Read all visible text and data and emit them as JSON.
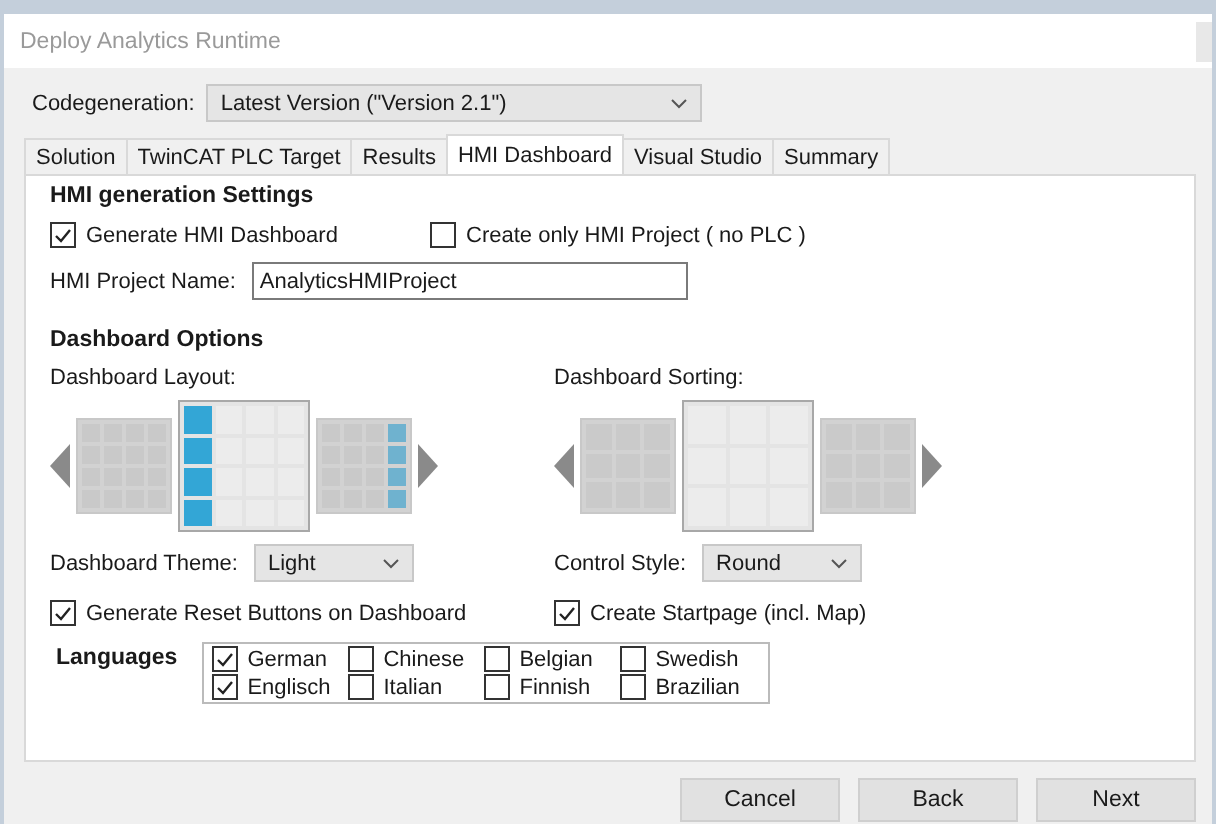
{
  "window": {
    "title": "Deploy Analytics Runtime"
  },
  "codegeneration": {
    "label": "Codegeneration:",
    "value": "Latest Version (\"Version 2.1\")"
  },
  "tabs": [
    {
      "label": "Solution",
      "selected": false
    },
    {
      "label": "TwinCAT PLC Target",
      "selected": false
    },
    {
      "label": "Results",
      "selected": false
    },
    {
      "label": "HMI Dashboard",
      "selected": true
    },
    {
      "label": "Visual Studio",
      "selected": false
    },
    {
      "label": "Summary",
      "selected": false
    }
  ],
  "hmi_settings": {
    "title": "HMI generation Settings",
    "options": [
      {
        "label": "Generate HMI Dashboard",
        "checked": true
      },
      {
        "label": "Create only HMI Project ( no PLC )",
        "checked": false
      }
    ],
    "project_name": {
      "label": "HMI Project Name:",
      "value": "AnalyticsHMIProject"
    }
  },
  "dashboard_options": {
    "title": "Dashboard Options",
    "layout": {
      "label": "Dashboard Layout:",
      "thumbnails": [
        {
          "selected": false
        },
        {
          "selected": true
        },
        {
          "selected": false
        }
      ]
    },
    "sorting": {
      "label": "Dashboard Sorting:",
      "thumbnails": [
        {
          "selected": false
        },
        {
          "selected": true
        },
        {
          "selected": false
        }
      ]
    },
    "theme": {
      "label": "Dashboard Theme:",
      "value": "Light"
    },
    "control_style": {
      "label": "Control Style:",
      "value": "Round"
    },
    "options": [
      {
        "label": "Generate Reset Buttons on Dashboard",
        "checked": true
      },
      {
        "label": "Create Startpage (incl. Map)",
        "checked": true
      }
    ],
    "languages": {
      "title": "Languages",
      "items": [
        {
          "label": "German",
          "checked": true
        },
        {
          "label": "Englisch",
          "checked": true
        },
        {
          "label": "Chinese",
          "checked": false
        },
        {
          "label": "Italian",
          "checked": false
        },
        {
          "label": "Belgian",
          "checked": false
        },
        {
          "label": "Finnish",
          "checked": false
        },
        {
          "label": "Swedish",
          "checked": false
        },
        {
          "label": "Brazilian",
          "checked": false
        }
      ]
    }
  },
  "buttons": [
    "Cancel",
    "Back",
    "Next"
  ]
}
